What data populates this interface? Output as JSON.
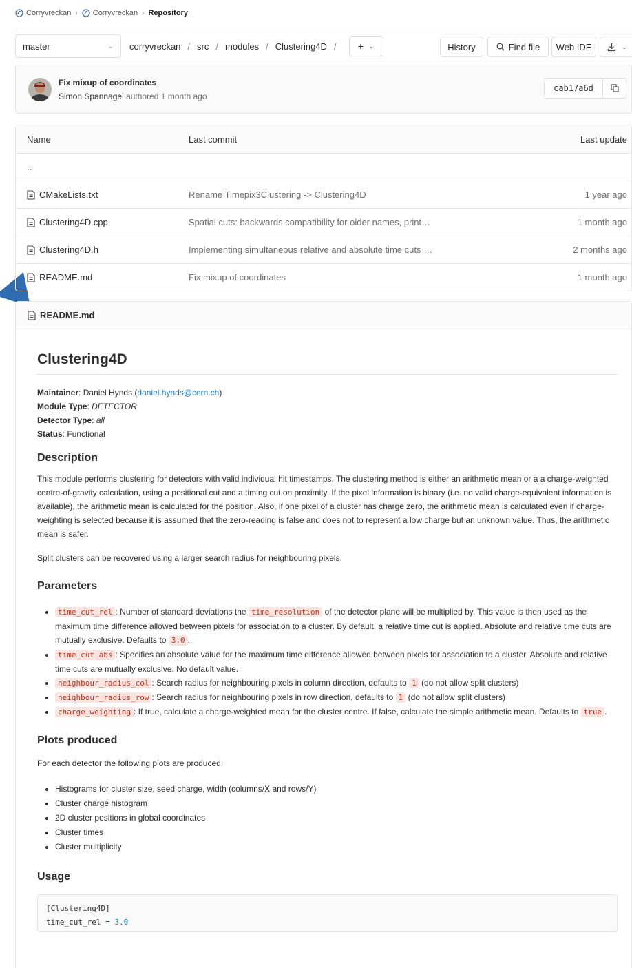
{
  "breadcrumb": {
    "items": [
      "Corryvreckan",
      "Corryvreckan"
    ],
    "current": "Repository"
  },
  "toolbar": {
    "branch": "master",
    "path": [
      "corryvreckan",
      "src",
      "modules",
      "Clustering4D"
    ],
    "history_label": "History",
    "find_file_label": "Find file",
    "web_ide_label": "Web IDE"
  },
  "last_commit": {
    "title": "Fix mixup of coordinates",
    "author": "Simon Spannagel",
    "authored_text": "authored 1 month ago",
    "sha": "cab17a6d"
  },
  "table": {
    "headers": {
      "name": "Name",
      "last_commit": "Last commit",
      "last_update": "Last update"
    },
    "parent": "..",
    "rows": [
      {
        "name": "CMakeLists.txt",
        "commit": "Rename Timepix3Clustering -> Clustering4D",
        "updated": "1 year ago"
      },
      {
        "name": "Clustering4D.cpp",
        "commit": "Spatial cuts: backwards compatibility for older names, print…",
        "updated": "1 month ago"
      },
      {
        "name": "Clustering4D.h",
        "commit": "Implementing simultaneous relative and absolute time cuts …",
        "updated": "2 months ago"
      },
      {
        "name": "README.md",
        "commit": "Fix mixup of coordinates",
        "updated": "1 month ago"
      }
    ]
  },
  "readme": {
    "filename": "README.md",
    "title": "Clustering4D",
    "maintainer_label": "Maintainer",
    "maintainer_name": "Daniel Hynds",
    "maintainer_email": "daniel.hynds@cern.ch",
    "module_type_label": "Module Type",
    "module_type": "DETECTOR",
    "detector_type_label": "Detector Type",
    "detector_type": "all",
    "status_label": "Status",
    "status": "Functional",
    "description_heading": "Description",
    "description_p1": "This module performs clustering for detectors with valid individual hit timestamps. The clustering method is either an arithmetic mean or a a charge-weighted centre-of-gravity calculation, using a positional cut and a timing cut on proximity. If the pixel information is binary (i.e. no valid charge-equivalent information is available), the arithmetic mean is calculated for the position. Also, if one pixel of a cluster has charge zero, the arithmetic mean is calculated even if charge-weighting is selected because it is assumed that the zero-reading is false and does not to represent a low charge but an unknown value. Thus, the arithmetic mean is safer.",
    "description_p2": "Split clusters can be recovered using a larger search radius for neighbouring pixels.",
    "parameters_heading": "Parameters",
    "params": {
      "p1_code": "time_cut_rel",
      "p1_a": ": Number of standard deviations the ",
      "p1_code2": "time_resolution",
      "p1_b": " of the detector plane will be multiplied by. This value is then used as the maximum time difference allowed between pixels for association to a cluster. By default, a relative time cut is applied. Absolute and relative time cuts are mutually exclusive. Defaults to ",
      "p1_default": "3.0",
      "p2_code": "time_cut_abs",
      "p2_a": ": Specifies an absolute value for the maximum time difference allowed between pixels for association to a cluster. Absolute and relative time cuts are mutually exclusive. No default value.",
      "p3_code": "neighbour_radius_col",
      "p3_a": ": Search radius for neighbouring pixels in column direction, defaults to ",
      "p3_default": "1",
      "p3_b": " (do not allow split clusters)",
      "p4_code": "neighbour_radius_row",
      "p4_a": ": Search radius for neighbouring pixels in row direction, defaults to ",
      "p4_default": "1",
      "p4_b": " (do not allow split clusters)",
      "p5_code": "charge_weighting",
      "p5_a": ": If true, calculate a charge-weighted mean for the cluster centre. If false, calculate the simple arithmetic mean. Defaults to ",
      "p5_default": "true"
    },
    "plots_heading": "Plots produced",
    "plots_intro": "For each detector the following plots are produced:",
    "plots": [
      "Histograms for cluster size, seed charge, width (columns/X and rows/Y)",
      "Cluster charge histogram",
      "2D cluster positions in global coordinates",
      "Cluster times",
      "Cluster multiplicity"
    ],
    "usage_heading": "Usage",
    "usage_line1": "[Clustering4D]",
    "usage_line2_key": "time_cut_rel = ",
    "usage_line2_val": "3.0"
  },
  "colors": {
    "link": "#1f78d1",
    "code_text": "#c0341d",
    "code_bg": "#fbe5e1",
    "arrow": "#2f6db0"
  }
}
